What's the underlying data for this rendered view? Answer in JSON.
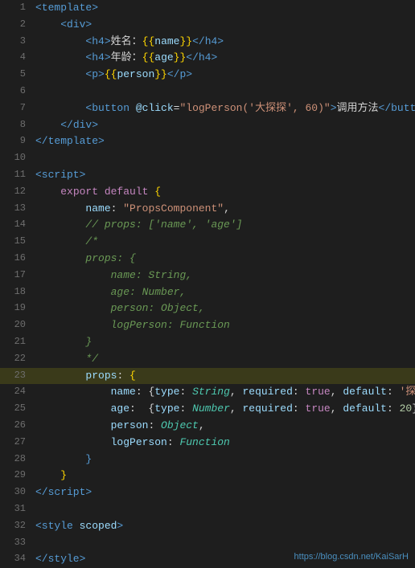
{
  "editor": {
    "lines": [
      {
        "num": 1,
        "content": "template_open",
        "highlight": false
      },
      {
        "num": 2,
        "content": "div_open",
        "highlight": false
      },
      {
        "num": 3,
        "content": "h4_name",
        "highlight": false
      },
      {
        "num": 4,
        "content": "h4_age",
        "highlight": false
      },
      {
        "num": 5,
        "content": "p_person",
        "highlight": false
      },
      {
        "num": 6,
        "content": "empty1",
        "highlight": false
      },
      {
        "num": 7,
        "content": "button_line",
        "highlight": false
      },
      {
        "num": 8,
        "content": "div_close",
        "highlight": false
      },
      {
        "num": 9,
        "content": "template_close",
        "highlight": false
      },
      {
        "num": 10,
        "content": "empty2",
        "highlight": false
      },
      {
        "num": 11,
        "content": "script_open",
        "highlight": false
      },
      {
        "num": 12,
        "content": "export_default",
        "highlight": false
      },
      {
        "num": 13,
        "content": "name_line",
        "highlight": false
      },
      {
        "num": 14,
        "content": "comment_props_array",
        "highlight": false
      },
      {
        "num": 15,
        "content": "comment_start",
        "highlight": false
      },
      {
        "num": 16,
        "content": "comment_props_obj",
        "highlight": false
      },
      {
        "num": 17,
        "content": "comment_name_string",
        "highlight": false
      },
      {
        "num": 18,
        "content": "comment_age_number",
        "highlight": false
      },
      {
        "num": 19,
        "content": "comment_person_object",
        "highlight": false
      },
      {
        "num": 20,
        "content": "comment_logperson_function",
        "highlight": false
      },
      {
        "num": 21,
        "content": "comment_brace_close",
        "highlight": false
      },
      {
        "num": 22,
        "content": "comment_end",
        "highlight": false
      },
      {
        "num": 23,
        "content": "props_line",
        "highlight": true
      },
      {
        "num": 24,
        "content": "name_type_line",
        "highlight": false
      },
      {
        "num": 25,
        "content": "age_type_line",
        "highlight": false
      },
      {
        "num": 26,
        "content": "person_object_line",
        "highlight": false
      },
      {
        "num": 27,
        "content": "logperson_function_line",
        "highlight": false
      },
      {
        "num": 28,
        "content": "obj_close_brace",
        "highlight": false
      },
      {
        "num": 29,
        "content": "export_close_brace",
        "highlight": false
      },
      {
        "num": 30,
        "content": "script_close",
        "highlight": false
      },
      {
        "num": 31,
        "content": "empty3",
        "highlight": false
      },
      {
        "num": 32,
        "content": "style_open",
        "highlight": false
      },
      {
        "num": 33,
        "content": "empty4",
        "highlight": false
      },
      {
        "num": 34,
        "content": "style_close",
        "highlight": false
      }
    ]
  },
  "watermark": "https://blog.csdn.net/KaiSarH"
}
